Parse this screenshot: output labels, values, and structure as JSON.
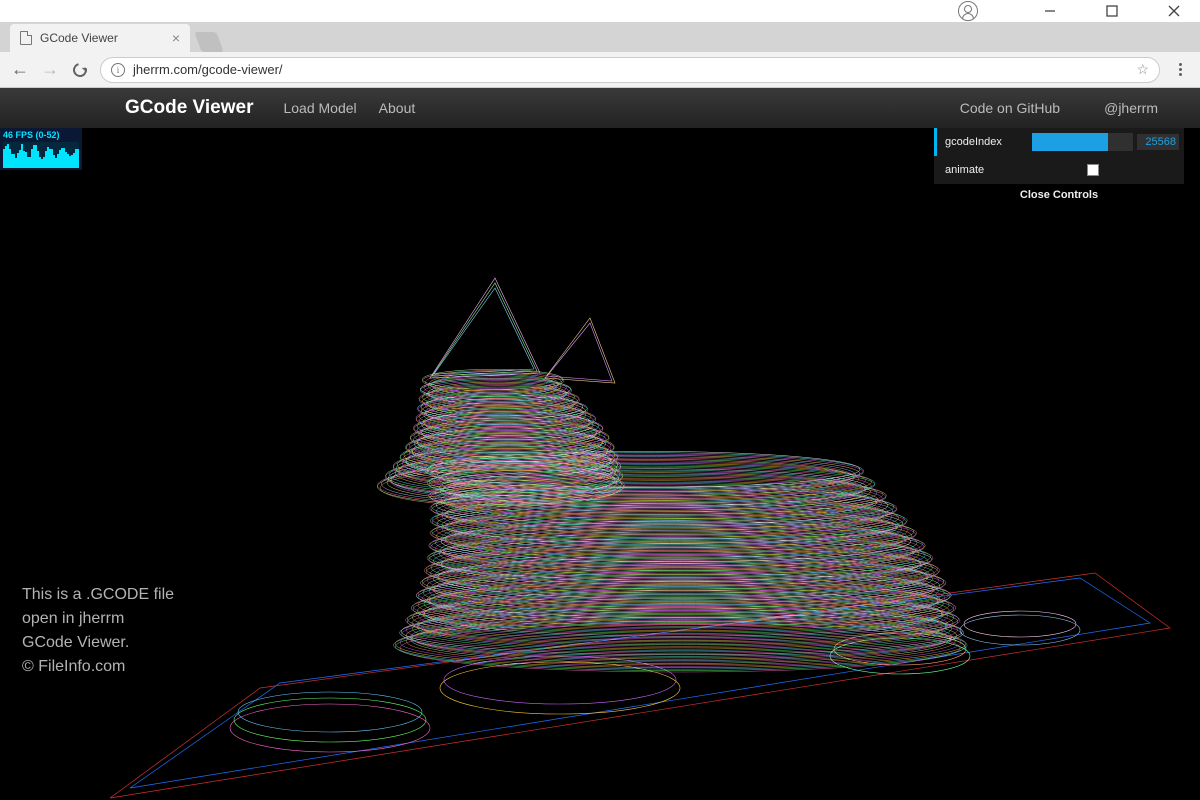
{
  "browser": {
    "tab_title": "GCode Viewer",
    "url": "jherrm.com/gcode-viewer/"
  },
  "app": {
    "title": "GCode Viewer",
    "nav": {
      "load_model": "Load Model",
      "about": "About",
      "github": "Code on GitHub",
      "twitter": "@jherrm"
    }
  },
  "fps": {
    "label": "46 FPS (0-52)"
  },
  "controls": {
    "gcode_index_label": "gcodeIndex",
    "gcode_index_value": "25568",
    "animate_label": "animate",
    "close": "Close Controls"
  },
  "caption": {
    "line1": "This is a .GCODE file",
    "line2": "open in jherrm",
    "line3": "GCode Viewer.",
    "line4": "© FileInfo.com"
  }
}
